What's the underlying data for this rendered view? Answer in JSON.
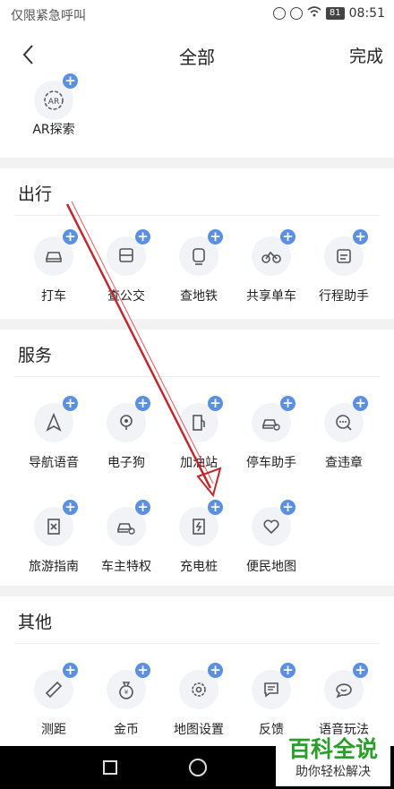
{
  "status_bar": {
    "carrier": "仅限紧急呼叫",
    "battery": "81",
    "time": "08:51"
  },
  "header": {
    "title": "全部",
    "done_label": "完成"
  },
  "top_section": {
    "items": [
      {
        "label": "AR探索",
        "icon": "ar-icon"
      }
    ]
  },
  "sections": [
    {
      "title": "出行",
      "items": [
        {
          "label": "打车",
          "icon": "car-icon"
        },
        {
          "label": "查公交",
          "icon": "bus-icon"
        },
        {
          "label": "查地铁",
          "icon": "subway-icon"
        },
        {
          "label": "共享单车",
          "icon": "bike-icon"
        },
        {
          "label": "行程助手",
          "icon": "calendar-icon"
        }
      ]
    },
    {
      "title": "服务",
      "items": [
        {
          "label": "导航语音",
          "icon": "navigation-icon"
        },
        {
          "label": "电子狗",
          "icon": "camera-icon"
        },
        {
          "label": "加油站",
          "icon": "gas-station-icon"
        },
        {
          "label": "停车助手",
          "icon": "parking-icon"
        },
        {
          "label": "查违章",
          "icon": "violation-icon"
        },
        {
          "label": "旅游指南",
          "icon": "travel-icon"
        },
        {
          "label": "车主特权",
          "icon": "car-owner-icon"
        },
        {
          "label": "充电桩",
          "icon": "charging-icon"
        },
        {
          "label": "便民地图",
          "icon": "heart-map-icon"
        }
      ]
    },
    {
      "title": "其他",
      "items": [
        {
          "label": "测距",
          "icon": "ruler-icon"
        },
        {
          "label": "金币",
          "icon": "coin-icon"
        },
        {
          "label": "地图设置",
          "icon": "settings-icon"
        },
        {
          "label": "反馈",
          "icon": "feedback-icon"
        },
        {
          "label": "语音玩法",
          "icon": "voice-icon"
        }
      ]
    }
  ],
  "watermark": {
    "title": "百科全说",
    "subtitle": "助你轻松解决"
  },
  "colors": {
    "plus_badge": "#5b8fdf",
    "arrow": "#c0282d",
    "watermark_green": "#2a9d2a"
  }
}
